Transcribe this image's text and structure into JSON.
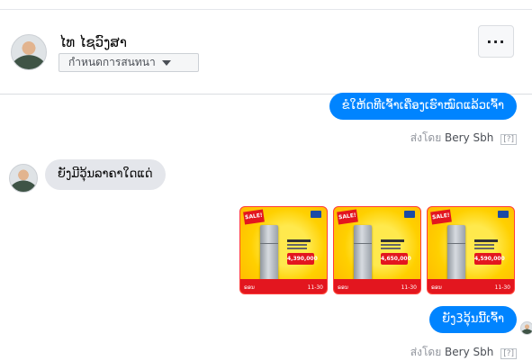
{
  "header": {
    "contact_name": "ໄທ ໄຊວົງສາ",
    "label_select": "กำหนดการสนทนา",
    "more_button": "···"
  },
  "messages": [
    {
      "direction": "outgoing",
      "text": "ຂໍໃຫ້ດທີເຈົ້າເຄື່ອງເຮົາໝົດແລ້ວເຈົ້າ"
    },
    {
      "direction": "incoming",
      "text": "ຍັງມີວຸ້ນລາຄາໃດແດ່"
    },
    {
      "direction": "outgoing",
      "text": "ຍັງ3ວຸ້ນນີ້ເຈົ້າ"
    }
  ],
  "sent_by": {
    "prefix": "ส่งโดย",
    "name": "Bery Sbh",
    "help": "[?]"
  },
  "photos": [
    {
      "sale": "SALE!",
      "price": "4,390,000",
      "foot_left": "ຣອນ",
      "foot_right": "11-30"
    },
    {
      "sale": "SALE!",
      "price": "4,650,000",
      "foot_left": "ຣອນ",
      "foot_right": "11-30"
    },
    {
      "sale": "SALE!",
      "price": "4,590,000",
      "foot_left": "ຣອນ",
      "foot_right": "11-30"
    }
  ],
  "colors": {
    "outgoing_bubble": "#0084ff",
    "incoming_bubble": "#e4e6eb",
    "photo_border": "#ff3c3c"
  }
}
